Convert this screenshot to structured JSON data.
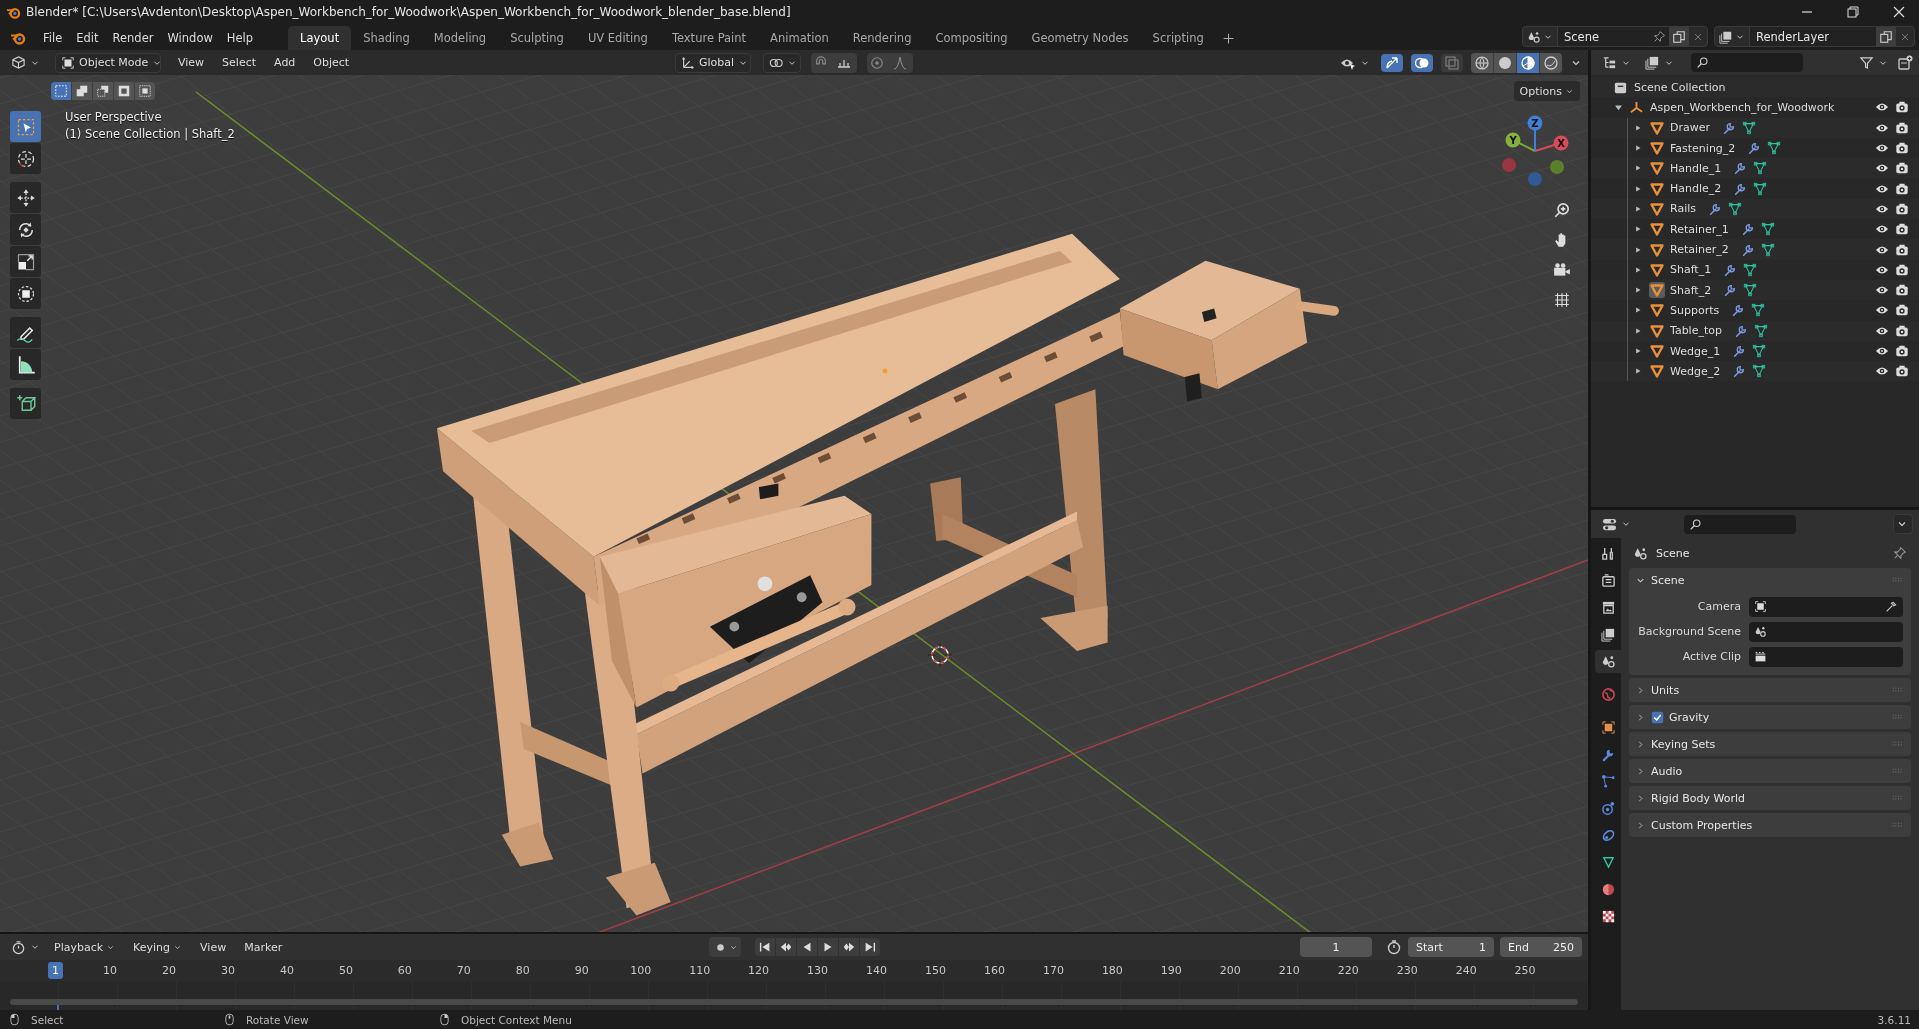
{
  "window": {
    "title": "Blender* [C:\\Users\\Avdenton\\Desktop\\Aspen_Workbench_for_Woodwork\\Aspen_Workbench_for_Woodwork_blender_base.blend]"
  },
  "menu": [
    "File",
    "Edit",
    "Render",
    "Window",
    "Help"
  ],
  "workspaces": [
    {
      "label": "Layout",
      "selected": true
    },
    {
      "label": "Shading",
      "selected": false
    },
    {
      "label": "Modeling",
      "selected": false
    },
    {
      "label": "Sculpting",
      "selected": false
    },
    {
      "label": "UV Editing",
      "selected": false
    },
    {
      "label": "Texture Paint",
      "selected": false
    },
    {
      "label": "Animation",
      "selected": false
    },
    {
      "label": "Rendering",
      "selected": false
    },
    {
      "label": "Compositing",
      "selected": false
    },
    {
      "label": "Geometry Nodes",
      "selected": false
    },
    {
      "label": "Scripting",
      "selected": false
    }
  ],
  "scene": {
    "name": "Scene"
  },
  "view_layer": {
    "name": "RenderLayer"
  },
  "viewport": {
    "mode": "Object Mode",
    "menus": [
      "View",
      "Select",
      "Add",
      "Object"
    ],
    "orientation": "Global",
    "options": "Options",
    "toggles": [
      {
        "kind": "gizmos",
        "on": true
      },
      {
        "kind": "overlays",
        "on": true
      },
      {
        "kind": "xray",
        "on": false
      }
    ],
    "shading": [
      {
        "kind": "wireframe",
        "selected": false
      },
      {
        "kind": "solid",
        "selected": false
      },
      {
        "kind": "material",
        "selected": true
      },
      {
        "kind": "rendered",
        "selected": false
      }
    ],
    "select_modes": [
      {
        "kind": "set",
        "selected": true
      },
      {
        "kind": "extend",
        "selected": false
      },
      {
        "kind": "subtract",
        "selected": false
      },
      {
        "kind": "invert",
        "selected": false
      },
      {
        "kind": "intersect",
        "selected": false
      }
    ],
    "tools": [
      {
        "kind": "select",
        "selected": true
      },
      {
        "kind": "cursor",
        "selected": false
      },
      {
        "kind": "move",
        "selected": false
      },
      {
        "kind": "rotate",
        "selected": false
      },
      {
        "kind": "scale",
        "selected": false
      },
      {
        "kind": "transform",
        "selected": false
      },
      {
        "kind": "annotate",
        "selected": false
      },
      {
        "kind": "measure",
        "selected": false
      },
      {
        "kind": "add_cube",
        "selected": false
      }
    ],
    "view_name": "User Perspective",
    "context": "(1) Scene Collection | Shaft_2",
    "gizmo": {
      "x": "X",
      "y": "Y",
      "z": "Z"
    }
  },
  "outliner": {
    "root": "Scene Collection",
    "collection": {
      "name": "Aspen_Workbench_for_Woodwork",
      "expanded": true,
      "children": [
        {
          "name": "Drawer",
          "expanded": false,
          "active": false
        },
        {
          "name": "Fastening_2",
          "expanded": false,
          "active": false
        },
        {
          "name": "Handle_1",
          "expanded": false,
          "active": false
        },
        {
          "name": "Handle_2",
          "expanded": false,
          "active": false
        },
        {
          "name": "Rails",
          "expanded": false,
          "active": false
        },
        {
          "name": "Retainer_1",
          "expanded": false,
          "active": false
        },
        {
          "name": "Retainer_2",
          "expanded": false,
          "active": false
        },
        {
          "name": "Shaft_1",
          "expanded": false,
          "active": false
        },
        {
          "name": "Shaft_2",
          "expanded": false,
          "active": true
        },
        {
          "name": "Supports",
          "expanded": false,
          "active": false
        },
        {
          "name": "Table_top",
          "expanded": false,
          "active": false
        },
        {
          "name": "Wedge_1",
          "expanded": false,
          "active": false
        },
        {
          "name": "Wedge_2",
          "expanded": false,
          "active": false
        }
      ]
    }
  },
  "properties": {
    "tabs": [
      {
        "kind": "tool",
        "selected": false
      },
      {
        "kind": "render",
        "selected": false
      },
      {
        "kind": "output",
        "selected": false
      },
      {
        "kind": "view_layer",
        "selected": false
      },
      {
        "kind": "scene",
        "selected": true
      },
      {
        "kind": "world",
        "selected": false
      },
      {
        "kind": "object",
        "selected": false
      },
      {
        "kind": "modifiers",
        "selected": false
      },
      {
        "kind": "particles",
        "selected": false
      },
      {
        "kind": "physics",
        "selected": false
      },
      {
        "kind": "constraints",
        "selected": false
      },
      {
        "kind": "data",
        "selected": false
      },
      {
        "kind": "material",
        "selected": false
      },
      {
        "kind": "texture",
        "selected": false
      }
    ],
    "context": "Scene",
    "panels": [
      {
        "kind": "plain",
        "title": "Scene",
        "expanded": true,
        "fields": [
          {
            "kind": "object",
            "label": "Camera"
          },
          {
            "kind": "scene",
            "label": "Background Scene"
          },
          {
            "kind": "clip",
            "label": "Active Clip"
          }
        ]
      },
      {
        "kind": "plain",
        "title": "Units",
        "expanded": false
      },
      {
        "kind": "checkbox",
        "title": "Gravity",
        "expanded": false,
        "checked": true
      },
      {
        "kind": "plain",
        "title": "Keying Sets",
        "expanded": false
      },
      {
        "kind": "plain",
        "title": "Audio",
        "expanded": false
      },
      {
        "kind": "plain",
        "title": "Rigid Body World",
        "expanded": false
      },
      {
        "kind": "plain",
        "title": "Custom Properties",
        "expanded": false
      }
    ]
  },
  "timeline": {
    "menus": [
      "Playback",
      "Keying",
      "View",
      "Marker"
    ],
    "current_frame": "1",
    "start_label": "Start",
    "start": "1",
    "end_label": "End",
    "end": "250",
    "playhead": "1",
    "ruler": [
      "10",
      "20",
      "30",
      "40",
      "50",
      "60",
      "70",
      "80",
      "90",
      "100",
      "110",
      "120",
      "130",
      "140",
      "150",
      "160",
      "170",
      "180",
      "190",
      "200",
      "210",
      "220",
      "230",
      "240",
      "250"
    ]
  },
  "status_bar": {
    "hints": [
      {
        "kind": "left",
        "label": "Select"
      },
      {
        "kind": "middle",
        "label": "Rotate View"
      },
      {
        "kind": "right",
        "label": "Object Context Menu"
      }
    ],
    "version": "3.6.11"
  }
}
